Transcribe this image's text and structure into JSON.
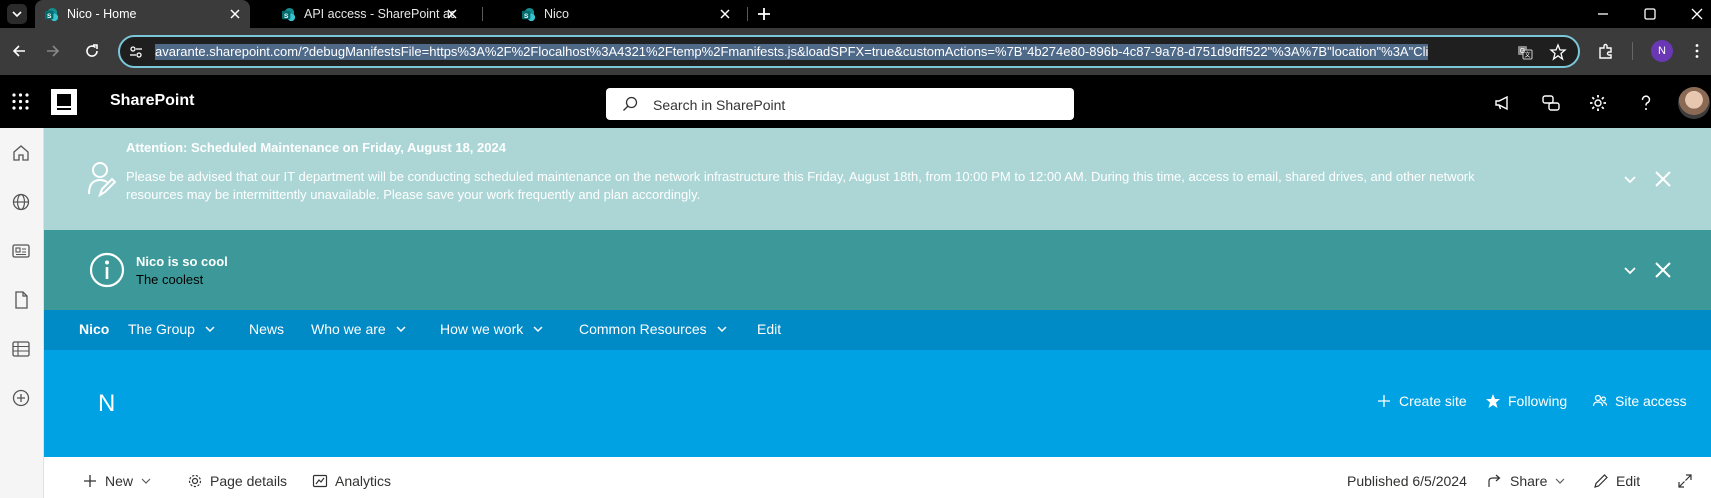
{
  "browser": {
    "tabs": [
      {
        "title": "Nico - Home",
        "active": true
      },
      {
        "title": "API access - SharePoint admin c",
        "active": false
      },
      {
        "title": "Nico",
        "active": false
      }
    ],
    "url": "avarante.sharepoint.com/?debugManifestsFile=https%3A%2F%2Flocalhost%3A4321%2Ftemp%2Fmanifests.js&loadSPFX=true&customActions=%7B\"4b274e80-896b-4c87-9a78-d751d9dff522\"%3A%7B\"location\"%3A\"Cli",
    "profile_initial": "N"
  },
  "suitebar": {
    "app_name": "SharePoint",
    "search_placeholder": "Search in SharePoint"
  },
  "banners": [
    {
      "title": "Attention: Scheduled Maintenance on Friday, August 18, 2024",
      "line1": "Please be advised that our IT department will be conducting scheduled maintenance on the network infrastructure this Friday, August 18th, from 10:00 PM to 12:00 AM. During this time, access to email, shared drives, and other network",
      "line2": "resources may be intermittently unavailable. Please save your work frequently and plan accordingly.",
      "color": "#acd6d6"
    },
    {
      "title": "Nico is so cool",
      "text": "The coolest",
      "color": "#3d9999"
    }
  ],
  "sitenav": {
    "items": [
      "Nico",
      "The Group",
      "News",
      "Who we are",
      "How we work",
      "Common Resources",
      "Edit"
    ]
  },
  "siteheader": {
    "logo_letter": "N",
    "actions": [
      "Create site",
      "Following",
      "Site access"
    ]
  },
  "commandbar": {
    "new_label": "New",
    "page_details_label": "Page details",
    "analytics_label": "Analytics",
    "published": "Published 6/5/2024",
    "share_label": "Share",
    "edit_label": "Edit"
  },
  "colors": {
    "nav_blue": "#008ac6",
    "header_blue": "#00a2e3",
    "accent_teal": "#3d9999"
  }
}
